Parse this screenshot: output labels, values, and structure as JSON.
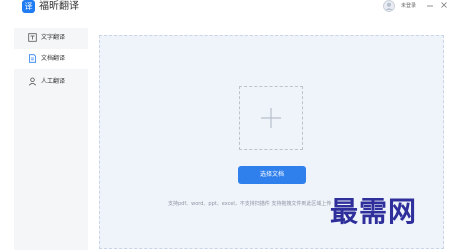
{
  "app": {
    "name": "福昕翻译",
    "logo_char": "译",
    "user_status": "未登录"
  },
  "sidebar": {
    "items": [
      {
        "label": "文字翻译",
        "icon": "text-icon"
      },
      {
        "label": "文档翻译",
        "icon": "document-icon",
        "active": true
      },
      {
        "label": "人工翻译",
        "icon": "person-icon"
      }
    ]
  },
  "main": {
    "select_button": "选择文档",
    "hint": "支持pdf、word、ppt、excel，不支持扫描件 支持拖拽文件到此区域上传"
  },
  "watermark": "最需网",
  "colors": {
    "accent": "#2f80ed",
    "panel_bg": "#eff3fa",
    "sidebar_bg": "#f5f6f8"
  }
}
